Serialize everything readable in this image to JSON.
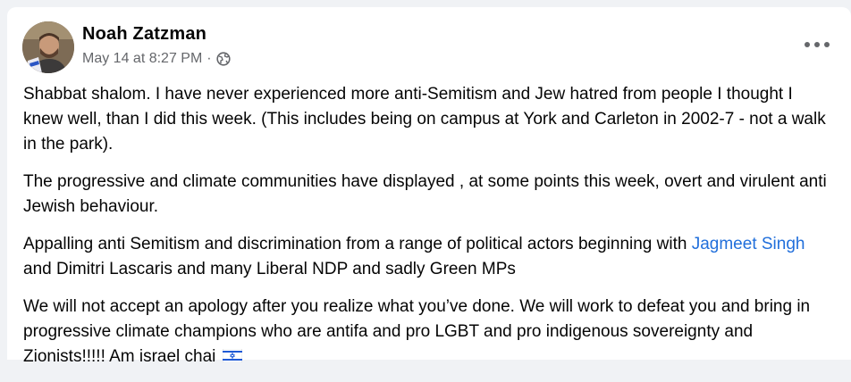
{
  "post": {
    "author": "Noah Zatzman",
    "timestamp": "May 14 at 8:27 PM",
    "separator": "·",
    "privacy_icon": "globe-icon",
    "more_icon": "more-options-icon",
    "paragraphs": {
      "p1": "Shabbat shalom. I have never experienced more anti-Semitism and Jew hatred from people I thought I knew well, than I did this week. (This includes being on campus at York and Carleton in 2002-7 - not a walk in the park).",
      "p2": "The progressive and climate communities have displayed , at some points this week, overt and virulent anti Jewish behaviour.",
      "p3_before": "Appalling anti Semitism and discrimination from a range of political actors beginning with",
      "p3_link": "Jagmeet Singh",
      "p3_after": " and Dimitri Lascaris and many Liberal NDP and sadly Green MPs",
      "p4": "We will not accept an apology after you realize what you’ve done.  We will work to defeat you and bring in progressive climate champions who are antifa and pro LGBT and pro indigenous sovereignty and Zionists!!!!!   Am israel chai",
      "p4_emoji": "israel-flag-icon"
    }
  },
  "colors": {
    "link": "#216fdb",
    "meta": "#65676b",
    "text": "#050505"
  }
}
